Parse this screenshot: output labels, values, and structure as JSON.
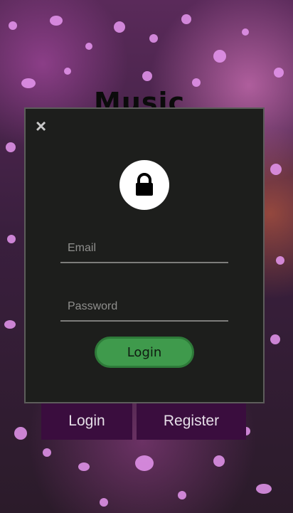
{
  "background": {
    "title": "Music",
    "buttons": {
      "login_label": "Login",
      "register_label": "Register"
    }
  },
  "modal": {
    "close_symbol": "×",
    "icon": "lock-icon",
    "email_placeholder": "Email",
    "password_placeholder": "Password",
    "submit_label": "Login",
    "colors": {
      "modal_bg": "#1d1e1c",
      "accent_green": "#3f9a4c",
      "button_purple": "#3a0d3e"
    }
  }
}
